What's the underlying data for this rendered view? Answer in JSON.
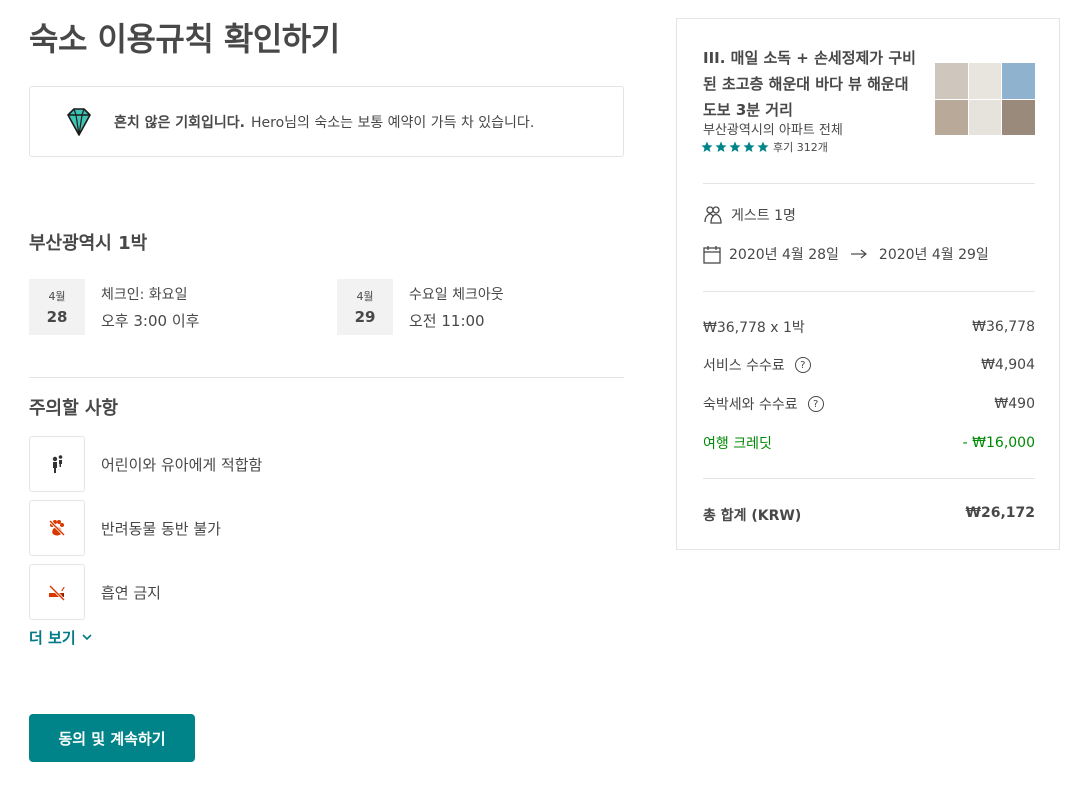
{
  "page": {
    "title": "숙소 이용규칙 확인하기"
  },
  "notice": {
    "bold": "흔치 않은 기회입니다.",
    "text": "Hero님의 숙소는 보통 예약이 가득 차 있습니다.",
    "icon": "diamond-icon"
  },
  "trip": {
    "title": "부산광역시 1박",
    "checkin": {
      "month": "4월",
      "day": "28",
      "line1": "체크인: 화요일",
      "line2": "오후 3:00 이후"
    },
    "checkout": {
      "month": "4월",
      "day": "29",
      "line1": "수요일 체크아웃",
      "line2": "오전 11:00"
    }
  },
  "rules": {
    "title": "주의할 사항",
    "items": [
      {
        "icon": "child-icon",
        "label": "어린이와 유아에게 적합함"
      },
      {
        "icon": "no-pets-icon",
        "label": "반려동물 동반 불가"
      },
      {
        "icon": "no-smoking-icon",
        "label": "흡연 금지"
      }
    ],
    "more": "더 보기"
  },
  "actions": {
    "agree": "동의 및 계속하기"
  },
  "listing": {
    "title": "III. 매일 소독 + 손세정제가 구비된 초고층 해운대 바다 뷰 해운대 도보 3분 거리",
    "subtitle": "부산광역시의 아파트 전체",
    "reviews": "후기 312개",
    "stars": 5,
    "star_color": "#008489"
  },
  "booking": {
    "guests": "게스트 1명",
    "date_from": "2020년 4월 28일",
    "date_to": "2020년 4월 29일"
  },
  "prices": {
    "nightly_label": "₩36,778 x 1박",
    "nightly_value": "₩36,778",
    "service_label": "서비스 수수료",
    "service_value": "₩4,904",
    "tax_label": "숙박세와 수수료",
    "tax_value": "₩490",
    "credit_label": "여행 크레딧",
    "credit_value": "- ₩16,000",
    "total_label": "총 합계 (KRW)",
    "total_value": "₩26,172"
  },
  "colors": {
    "accent": "#008489",
    "link": "#007a87",
    "credit": "#008a05",
    "rule_icon": "#d93900"
  }
}
